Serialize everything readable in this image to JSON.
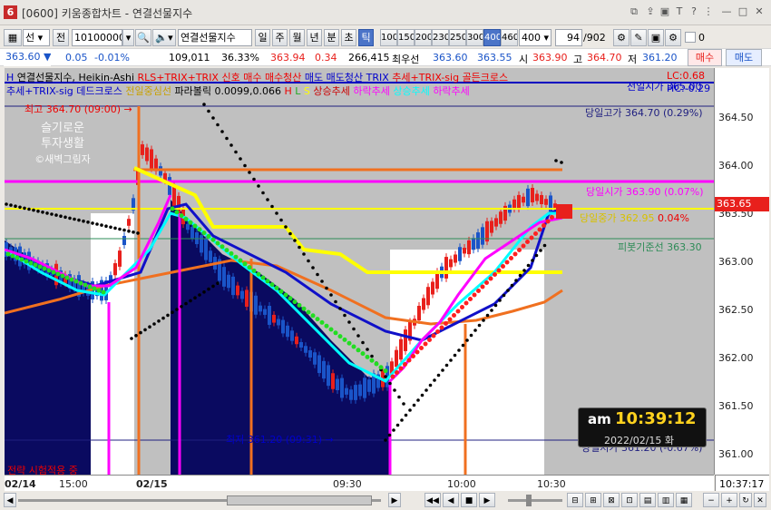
{
  "window": {
    "code": "[0600]",
    "title": "키움종합차트 - 연결선물지수",
    "app_icon": "6"
  },
  "toolbar": {
    "combo_type": "선",
    "jeon_label": "전",
    "item_code": "10100000",
    "item_name": "연결선물지수",
    "periods": [
      "일",
      "주",
      "월",
      "년",
      "분",
      "초",
      "틱"
    ],
    "selected_period": "틱",
    "tick_options": [
      "100",
      "150",
      "200",
      "230",
      "250",
      "300",
      "400",
      "460"
    ],
    "selected_tick": "400",
    "tick_value": "400",
    "page_count": "94",
    "page_total": "/902",
    "checkbox_value": "0"
  },
  "quotes": {
    "price": "363.60",
    "change": "0.05",
    "change_pct": "-0.01%",
    "volume": "109,011",
    "ratio": "36.33%",
    "f1": "363.94",
    "f2": "0.34",
    "f3": "266,415",
    "label_best": "최우선",
    "ask": "363.60",
    "bid": "363.55",
    "open_label": "시",
    "open": "363.90",
    "high_label": "고",
    "high": "364.70",
    "low_label": "저",
    "low": "361.20",
    "buy_btn": "매수",
    "sell_btn": "매도"
  },
  "legend": {
    "line1": "연결선물지수, Heikin-Ashi",
    "line1_red": "RLS+TRIX+TRIX 신호 매수 매수청산",
    "line1_blue": "매도 매도청산 TRIX",
    "line1_red2": "추세+TRIX-sig 골든크로스",
    "line2_a": "추세+TRIX-sig 데드크로스",
    "line2_b": "전일중심선",
    "line2_c": "파라볼릭 0.0099,0.066",
    "line2_h": "H",
    "line2_l": "L",
    "line2_s": "S",
    "line2_d": "상승추세",
    "line2_e": "하락추세",
    "line2_f": "상승추세",
    "line2_g": "하락추세",
    "lc": "LC:0.68",
    "hc": "HC:-0.29"
  },
  "chart_labels": {
    "prev_open": "전일시가 365.00",
    "day_high": "당일고가 364.70 (0.29%)",
    "day_open": "당일시가 363.90 (0.07%)",
    "mid": "당일중가 362.95",
    "mid_pct": "0.04%",
    "pivot": "피봇기준선 363.30",
    "day_low": "당일저가 361.20 (-0.67%)",
    "high_mark": "최고 364.70 (09:00)",
    "low_mark": "최저 361.20 (09:31)",
    "strategy": "전략 시험적용 중",
    "current_price": "363.65",
    "watermark_line1": "슬기로운",
    "watermark_line2": "투자생활",
    "watermark_line3": "©새벽그림자"
  },
  "y_ticks": [
    "364.50",
    "364.00",
    "363.50",
    "363.00",
    "362.50",
    "362.00",
    "361.50",
    "361.00"
  ],
  "x_ticks": [
    "02/14",
    "15:00",
    "02/15",
    "09:30",
    "10:00",
    "10:30"
  ],
  "clock": {
    "ampm": "am",
    "time": "10:39:12",
    "date": "2022/02/15 화"
  },
  "status_time": "10:37:17",
  "colors": {
    "up": "#e8201c",
    "down": "#1a54c8",
    "magenta": "#ff00ff",
    "yellow": "#ffff00",
    "orange": "#f07020",
    "cyan": "#00ffff",
    "navy": "#0a0a60"
  }
}
